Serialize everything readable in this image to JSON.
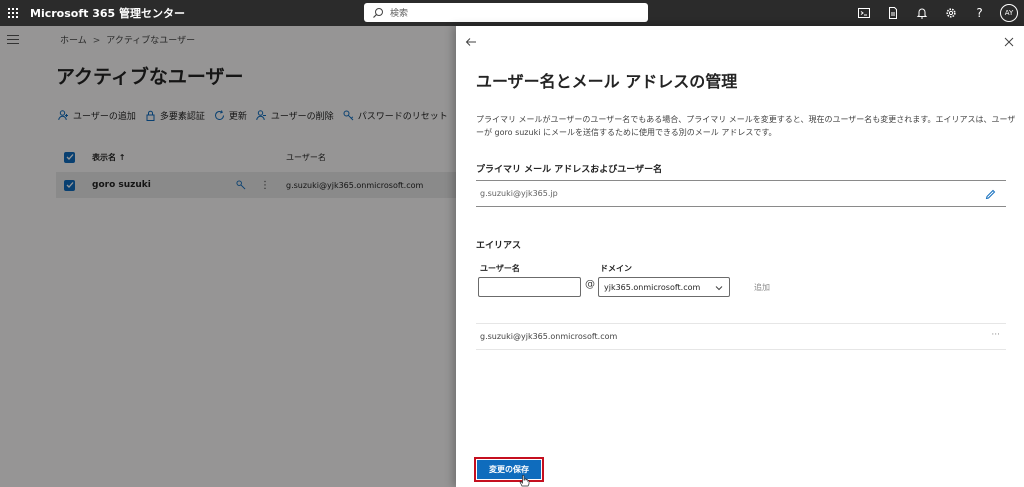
{
  "topbar": {
    "app_title": "Microsoft 365 管理センター",
    "search_placeholder": "検索",
    "avatar_initials": "AY",
    "icons": [
      "terminal-icon",
      "document-icon",
      "bell-icon",
      "gear-icon",
      "help-icon"
    ]
  },
  "page": {
    "breadcrumb": [
      "ホーム",
      "アクティブなユーザー"
    ],
    "title": "アクティブなユーザー",
    "commands": [
      {
        "label": "ユーザーの追加",
        "icon": "person-add-icon"
      },
      {
        "label": "多要素認証",
        "icon": "lock-icon"
      },
      {
        "label": "更新",
        "icon": "refresh-icon"
      },
      {
        "label": "ユーザーの削除",
        "icon": "person-remove-icon"
      },
      {
        "label": "パスワードのリセット",
        "icon": "key-icon"
      }
    ],
    "table": {
      "headers": {
        "name": "表示名 ↑",
        "upn": "ユーザー名"
      },
      "rows": [
        {
          "name": "goro suzuki",
          "upn": "g.suzuki@yjk365.onmicrosoft.com",
          "selected": true
        }
      ]
    }
  },
  "panel": {
    "title": "ユーザー名とメール アドレスの管理",
    "description": "プライマリ メールがユーザーのユーザー名でもある場合、プライマリ メールを変更すると、現在のユーザー名も変更されます。エイリアスは、ユーザーが goro suzuki にメールを送信するために使用できる別のメール アドレスです。",
    "primary_section_label": "プライマリ メール アドレスおよびユーザー名",
    "primary_value": "g.suzuki@yjk365.jp",
    "alias_section_label": "エイリアス",
    "username_label": "ユーザー名",
    "username_value": "",
    "at_sign": "@",
    "domain_label": "ドメイン",
    "domain_value": "yjk365.onmicrosoft.com",
    "add_label": "追加",
    "aliases": [
      "g.suzuki@yjk365.onmicrosoft.com"
    ],
    "alias_more": "···",
    "save_label": "変更の保存"
  },
  "colors": {
    "topbar_bg": "#2b2b2b",
    "accent": "#0f6cbd",
    "highlight_border": "#c50f1f"
  }
}
